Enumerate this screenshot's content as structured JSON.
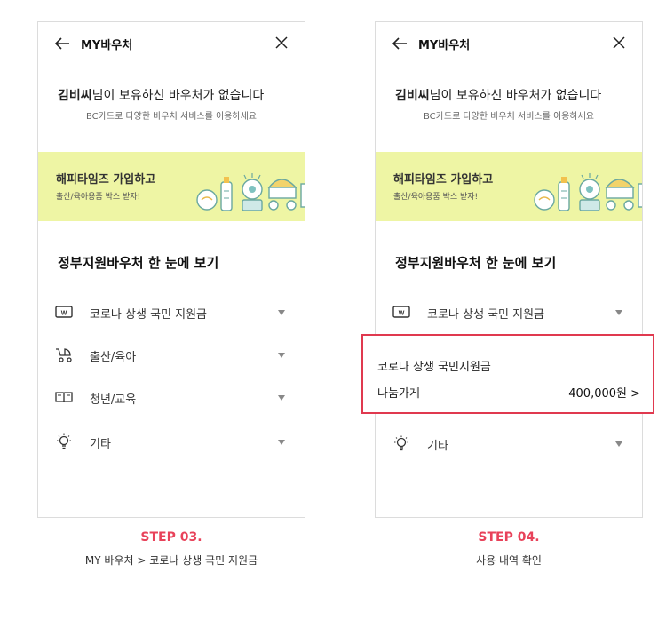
{
  "colors": {
    "accent": "#e8425a",
    "banner_bg": "#eef5a4",
    "highlight_border": "#e0394f"
  },
  "screen": {
    "title": "MY바우처",
    "empty_user": "김비씨",
    "empty_msg": "님이 보유하신 바우처가 없습니다",
    "empty_sub": "BC카드로 다양한 바우처 서비스를 이용하세요",
    "banner": {
      "title": "해피타임즈 가입하고",
      "sub": "출산/육아용품 박스 받자!"
    },
    "section_title": "정부지원바우처 한 눈에 보기",
    "categories": [
      {
        "label": "코로나 상생 국민 지원금",
        "icon": "voucher-card-icon"
      },
      {
        "label": "출산/육아",
        "icon": "stroller-icon"
      },
      {
        "label": "청년/교육",
        "icon": "book-icon"
      },
      {
        "label": "기타",
        "icon": "lightbulb-icon"
      }
    ]
  },
  "popup": {
    "title": "코로나 상생 국민지원금",
    "shop": "나눔가게",
    "amount": "400,000원 >"
  },
  "steps": [
    {
      "label": "STEP 03.",
      "desc": "MY 바우처 > 코로나 상생 국민 지원금"
    },
    {
      "label": "STEP 04.",
      "desc": "사용 내역 확인"
    }
  ]
}
